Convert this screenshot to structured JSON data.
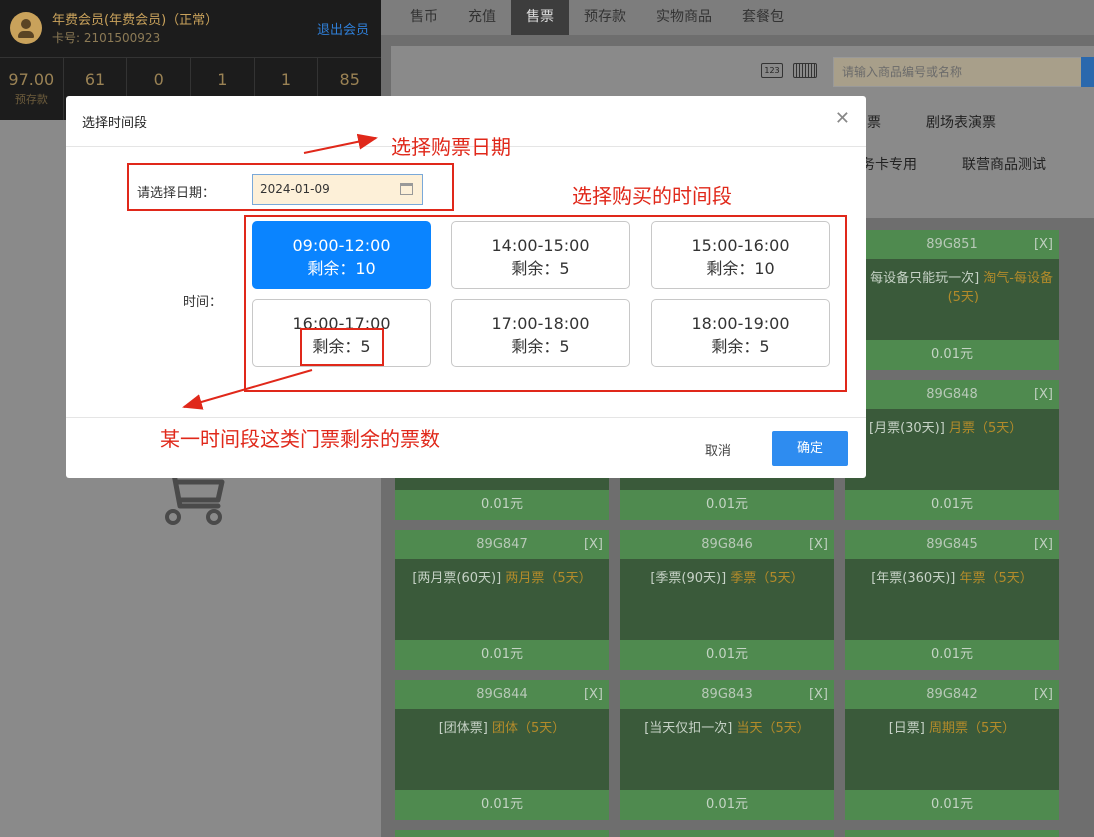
{
  "member": {
    "name": "年费会员(年费会员)（正常）",
    "card_no": "卡号: 2101500923",
    "logout": "退出会员"
  },
  "stats": [
    {
      "value": "97.00",
      "label": "预存款"
    },
    {
      "value": "61",
      "label": ""
    },
    {
      "value": "0",
      "label": ""
    },
    {
      "value": "1",
      "label": ""
    },
    {
      "value": "1",
      "label": ""
    },
    {
      "value": "85",
      "label": ""
    }
  ],
  "tabs": [
    {
      "label": "售币"
    },
    {
      "label": "充值"
    },
    {
      "label": "售票"
    },
    {
      "label": "预存款"
    },
    {
      "label": "实物商品"
    },
    {
      "label": "套餐包"
    }
  ],
  "search": {
    "placeholder": "请输入商品编号或名称"
  },
  "keyboard_icon_text": "123",
  "categories": [
    "票",
    "剧场表演票",
    "务卡专用",
    "联营商品测试"
  ],
  "products": [
    {
      "code": "89G851",
      "x": "[X]",
      "name": "每设备只能玩一次]",
      "tag": "淘气-每设备",
      "tag2": "(5天)",
      "price": "0.01元"
    },
    {
      "code": "89G848",
      "x": "[X]",
      "name": "[月票(30天)]",
      "tag": "月票（5天）",
      "tag2": "",
      "price": "0.01元"
    },
    {
      "code": "",
      "x": "",
      "name": "",
      "tag": "",
      "tag2": "",
      "price": "0.01元"
    },
    {
      "code": "",
      "x": "",
      "name": "",
      "tag": "",
      "tag2": "",
      "price": "0.01元"
    },
    {
      "code": "89G847",
      "x": "[X]",
      "name": "[两月票(60天)]",
      "tag": "两月票（5天）",
      "tag2": "",
      "price": "0.01元"
    },
    {
      "code": "89G846",
      "x": "[X]",
      "name": "[季票(90天)]",
      "tag": "季票（5天）",
      "tag2": "",
      "price": "0.01元"
    },
    {
      "code": "89G845",
      "x": "[X]",
      "name": "[年票(360天)]",
      "tag": "年票（5天）",
      "tag2": "",
      "price": "0.01元"
    },
    {
      "code": "89G844",
      "x": "[X]",
      "name": "[团体票]",
      "tag": "团体（5天）",
      "tag2": "",
      "price": "0.01元"
    },
    {
      "code": "89G843",
      "x": "[X]",
      "name": "[当天仅扣一次]",
      "tag": "当天（5天）",
      "tag2": "",
      "price": "0.01元"
    },
    {
      "code": "89G842",
      "x": "[X]",
      "name": "[日票]",
      "tag": "周期票（5天）",
      "tag2": "",
      "price": "0.01元"
    }
  ],
  "dialog": {
    "title": "选择时间段",
    "date_label": "请选择日期：",
    "date_value": "2024-01-09",
    "time_label": "时间：",
    "slots": [
      {
        "time": "09:00-12:00",
        "remain": "剩余：10",
        "selected": true
      },
      {
        "time": "14:00-15:00",
        "remain": "剩余：5",
        "selected": false
      },
      {
        "time": "15:00-16:00",
        "remain": "剩余：10",
        "selected": false
      },
      {
        "time": "16:00-17:00",
        "remain": "剩余：5",
        "selected": false
      },
      {
        "time": "17:00-18:00",
        "remain": "剩余：5",
        "selected": false
      },
      {
        "time": "18:00-19:00",
        "remain": "剩余：5",
        "selected": false
      }
    ],
    "cancel": "取消",
    "ok": "确定"
  },
  "annotations": {
    "date": "选择购票日期",
    "slots": "选择购买的时间段",
    "remain": "某一时间段这类门票剩余的票数"
  },
  "colors": {
    "accent": "#0a84ff",
    "annotation": "#e0281a",
    "card_green": "#4f8a4f"
  }
}
